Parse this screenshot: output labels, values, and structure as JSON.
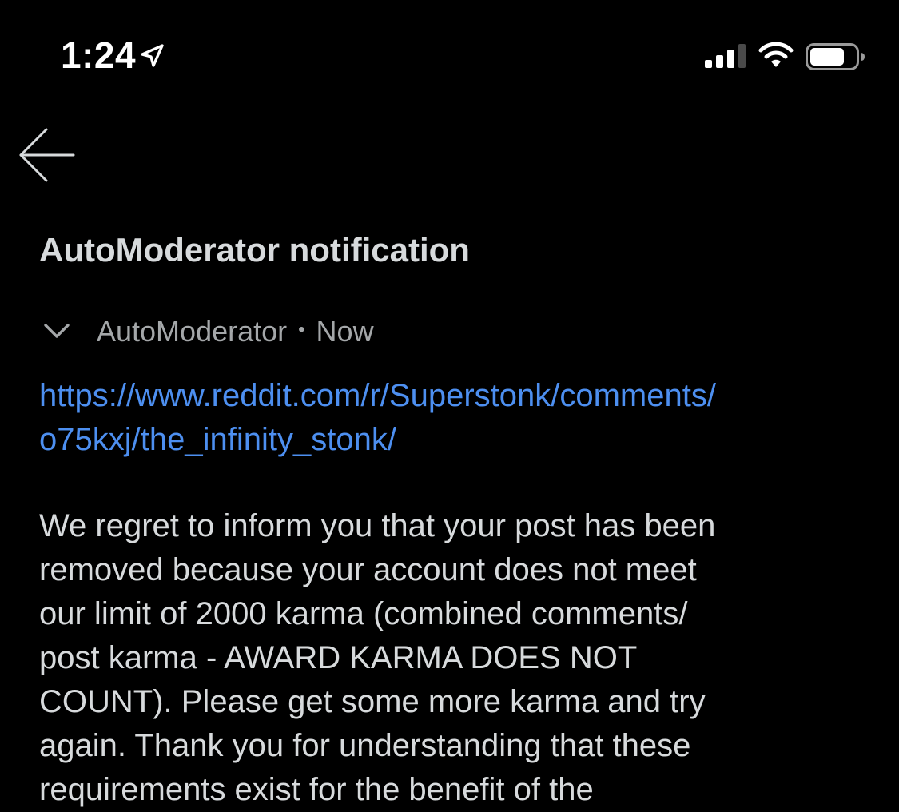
{
  "status_bar": {
    "time": "1:24",
    "location_icon": "location-arrow-icon",
    "signal_icon": "cellular-signal-icon",
    "wifi_icon": "wifi-icon",
    "battery_icon": "battery-icon"
  },
  "nav": {
    "back_icon": "arrow-left-icon"
  },
  "message": {
    "title": "AutoModerator notification",
    "collapse_icon": "chevron-down-icon",
    "author": "AutoModerator",
    "separator": "•",
    "time": "Now",
    "link_lines": [
      "https://www.reddit.com/r/Superstonk/comments/",
      "o75kxj/the_infinity_stonk/"
    ],
    "body_lines": [
      "We regret to inform you that your post has been",
      "removed because your account does not meet",
      "our limit of 2000 karma (combined comments/",
      "post karma - AWARD KARMA DOES NOT",
      "COUNT). Please get some more karma and try",
      "again. Thank you for understanding that these",
      "requirements exist for the benefit of the"
    ]
  },
  "colors": {
    "background": "#000000",
    "text_primary": "#d7dadc",
    "text_secondary": "#a4a7a9",
    "link": "#4d8ff0",
    "status_white": "#ffffff",
    "signal_inactive": "#4a4a4a"
  }
}
